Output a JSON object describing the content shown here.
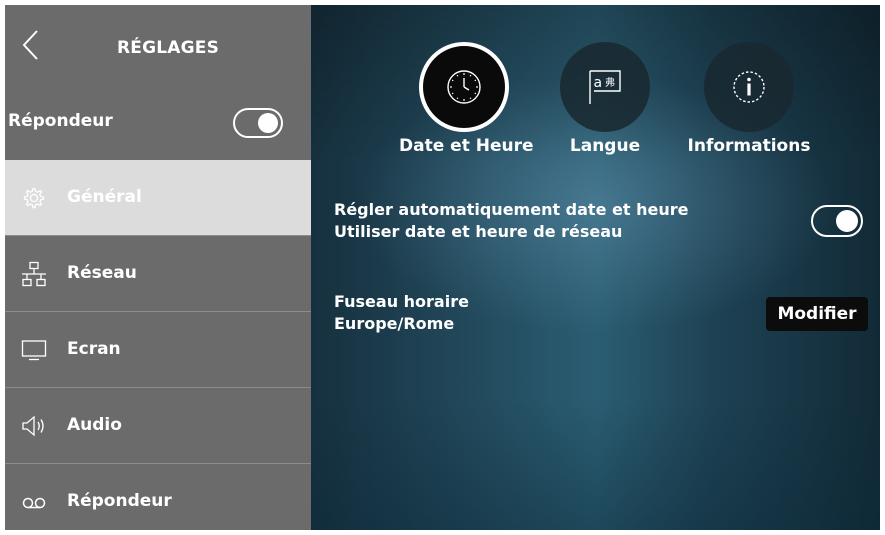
{
  "sidebar": {
    "title": "RÉGLAGES",
    "toggle_label": "Répondeur",
    "toggle_state": "on",
    "items": [
      {
        "label": "Général",
        "icon": "gear-icon",
        "active": true
      },
      {
        "label": "Réseau",
        "icon": "network-icon",
        "active": false
      },
      {
        "label": "Ecran",
        "icon": "monitor-icon",
        "active": false
      },
      {
        "label": "Audio",
        "icon": "speaker-icon",
        "active": false
      },
      {
        "label": "Répondeur",
        "icon": "voicemail-icon",
        "active": false
      }
    ]
  },
  "main": {
    "tabs": [
      {
        "label": "Date et Heure",
        "icon": "clock-icon",
        "active": true
      },
      {
        "label": "Langue",
        "icon": "language-icon",
        "active": false
      },
      {
        "label": "Informations",
        "icon": "info-icon",
        "active": false
      }
    ],
    "auto_time": {
      "title": "Régler automatiquement date et heure",
      "subtitle": "Utiliser date et heure de réseau",
      "toggle_state": "on"
    },
    "timezone": {
      "title": "Fuseau horaire",
      "value": "Europe/Rome",
      "button_label": "Modifier"
    }
  },
  "colors": {
    "sidebar_bg": "#6b6b6b",
    "active_item_bg": "#dcdcdc",
    "button_bg": "#0c0c0c",
    "text": "#ffffff"
  }
}
